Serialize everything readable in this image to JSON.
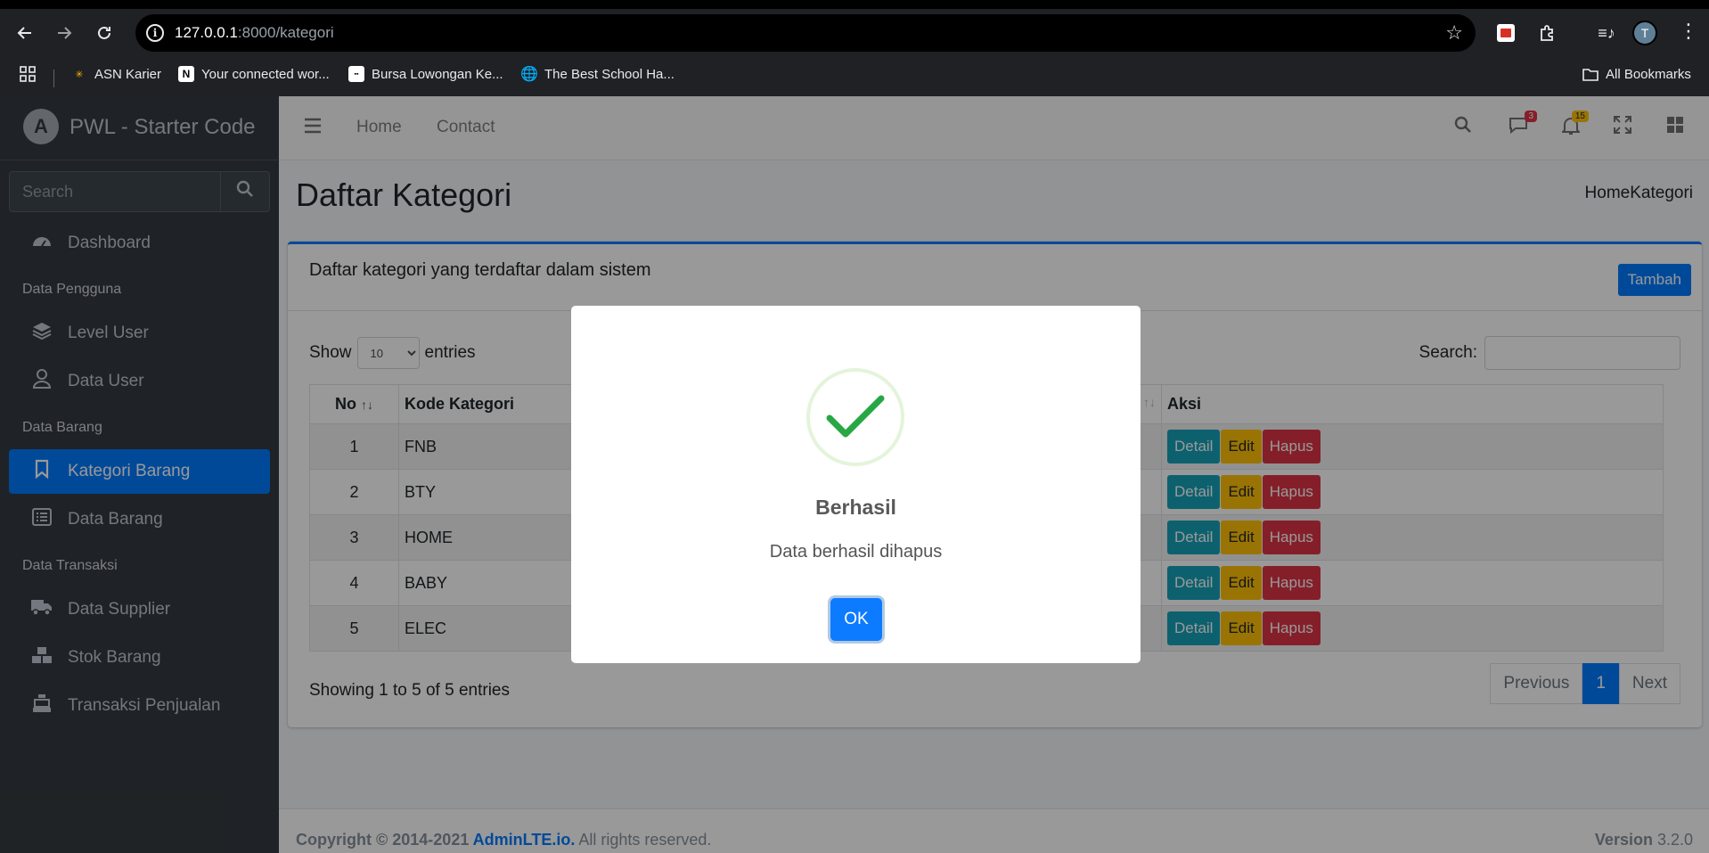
{
  "browser": {
    "url_host": "127.0.0.1",
    "url_path": ":8000/kategori",
    "avatar_letter": "T",
    "bookmarks": [
      {
        "label": "ASN Karier"
      },
      {
        "label": "Your connected wor..."
      },
      {
        "label": "Bursa Lowongan Ke..."
      },
      {
        "label": "The Best School Ha..."
      }
    ],
    "all_bookmarks": "All Bookmarks"
  },
  "sidebar": {
    "brand": "PWL - Starter Code",
    "search_placeholder": "Search",
    "dashboard": "Dashboard",
    "section_pengguna": "Data Pengguna",
    "level_user": "Level User",
    "data_user": "Data User",
    "section_barang": "Data Barang",
    "kategori_barang": "Kategori Barang",
    "data_barang": "Data Barang",
    "section_transaksi": "Data Transaksi",
    "data_supplier": "Data Supplier",
    "stok_barang": "Stok Barang",
    "transaksi_penjualan": "Transaksi Penjualan"
  },
  "topnav": {
    "home": "Home",
    "contact": "Contact",
    "messages_count": "3",
    "notifications_count": "15"
  },
  "content": {
    "title": "Daftar Kategori",
    "breadcrumb": "HomeKategori",
    "card_title": "Daftar kategori yang terdaftar dalam sistem",
    "add_button": "Tambah",
    "show_label": "Show",
    "entries_label": "entries",
    "page_length": "10",
    "search_label": "Search:",
    "columns": {
      "no": "No",
      "kode": "Kode Kategori",
      "aksi": "Aksi"
    },
    "rows": [
      {
        "no": "1",
        "kode": "FNB"
      },
      {
        "no": "2",
        "kode": "BTY"
      },
      {
        "no": "3",
        "kode": "HOME"
      },
      {
        "no": "4",
        "kode": "BABY"
      },
      {
        "no": "5",
        "kode": "ELEC"
      }
    ],
    "actions": {
      "detail": "Detail",
      "edit": "Edit",
      "hapus": "Hapus"
    },
    "info": "Showing 1 to 5 of 5 entries",
    "pager": {
      "previous": "Previous",
      "current": "1",
      "next": "Next"
    }
  },
  "footer": {
    "copyright": "Copyright © 2014-2021 ",
    "brand_link": "AdminLTE.io.",
    "rights": " All rights reserved.",
    "version_label": "Version",
    "version": " 3.2.0"
  },
  "modal": {
    "title": "Berhasil",
    "text": "Data berhasil dihapus",
    "ok": "OK"
  },
  "colors": {
    "primary": "#007bff",
    "sidebar_bg": "#343a40",
    "info": "#17a2b8",
    "warning": "#ffc107",
    "danger": "#dc3545",
    "success": "#28a745"
  }
}
